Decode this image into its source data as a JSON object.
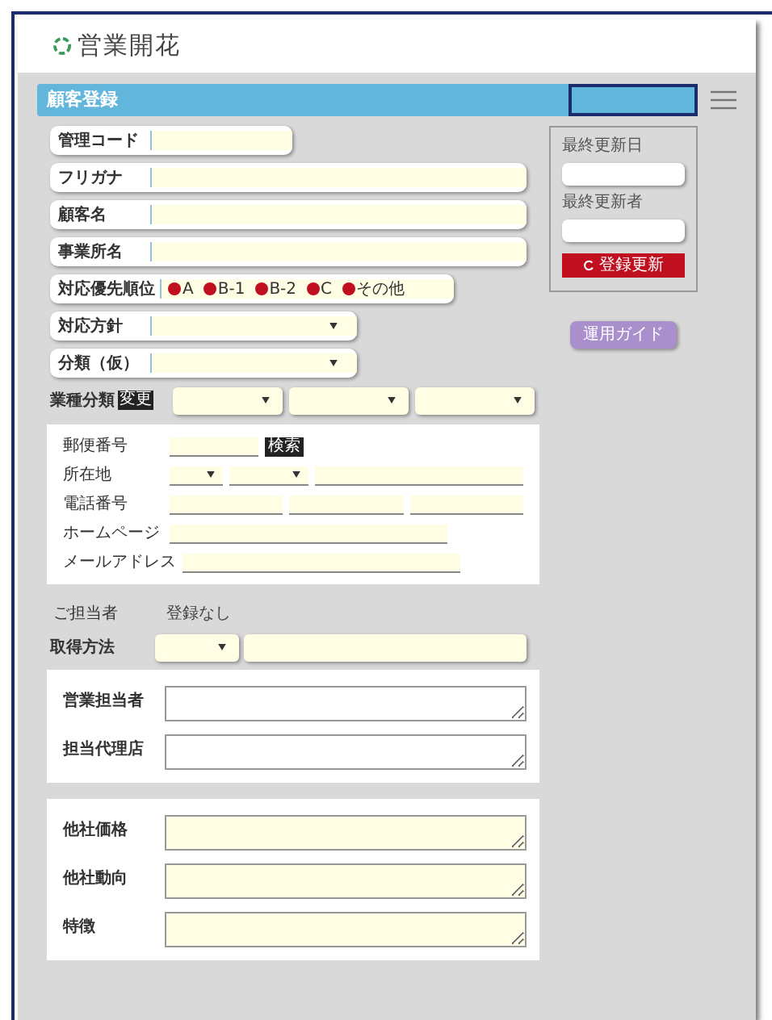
{
  "logo": {
    "text": "営業開花"
  },
  "title_bar": {
    "title": "顧客登録"
  },
  "fields": [
    {
      "kind": "code",
      "label": "管理コード"
    },
    {
      "kind": "text",
      "label": "フリガナ"
    },
    {
      "kind": "text",
      "label": "顧客名"
    },
    {
      "kind": "text",
      "label": "事業所名"
    },
    {
      "kind": "radio",
      "label": "対応優先順位",
      "options": [
        {
          "label": "A",
          "selected": false
        },
        {
          "label": "B-1",
          "selected": false
        },
        {
          "label": "B-2",
          "selected": false
        },
        {
          "label": "C",
          "selected": false
        },
        {
          "label": "その他",
          "selected": false
        }
      ]
    },
    {
      "kind": "select",
      "label": "対応方針"
    },
    {
      "kind": "select",
      "label": "分類（仮）"
    }
  ],
  "industry": {
    "label": "業種分類",
    "badge": "変更"
  },
  "contact_rows": [
    {
      "kind": "postal",
      "label": "郵便番号",
      "button": "検索"
    },
    {
      "kind": "address",
      "label": "所在地"
    },
    {
      "kind": "phone",
      "label": "電話番号"
    },
    {
      "kind": "line",
      "label": "ホームページ"
    },
    {
      "kind": "line",
      "label": "メールアドレス"
    }
  ],
  "person": {
    "label": "ご担当者",
    "value": "登録なし"
  },
  "acquisition": {
    "label": "取得方法"
  },
  "sales_panel": [
    {
      "label": "営業担当者"
    },
    {
      "label": "担当代理店"
    }
  ],
  "competitor_panel": [
    {
      "label": "他社価格"
    },
    {
      "label": "他社動向"
    },
    {
      "label": "特徴"
    }
  ],
  "side": {
    "last_updated_label": "最終更新日",
    "last_updater_label": "最終更新者",
    "update_button": "登録更新",
    "guide_button": "運用ガイド"
  }
}
